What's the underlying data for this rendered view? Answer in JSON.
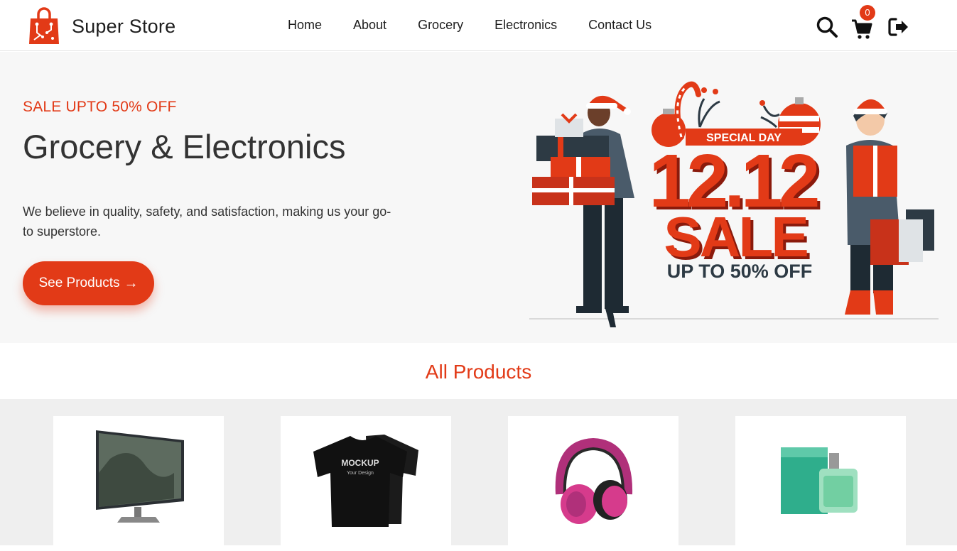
{
  "brand": {
    "name": "Super Store"
  },
  "nav": {
    "items": [
      "Home",
      "About",
      "Grocery",
      "Electronics",
      "Contact Us"
    ]
  },
  "header_actions": {
    "cart_count": "0",
    "icons": [
      "search-icon",
      "cart-icon",
      "logout-icon"
    ]
  },
  "hero": {
    "sale_text": "SALE UPTO 50% OFF",
    "title": "Grocery & Electronics",
    "description": "We believe in quality, safety, and satisfaction, making us your go-to superstore.",
    "button_label": "See Products",
    "banner": {
      "special_day": "SPECIAL DAY",
      "date": "12.12",
      "sale": "SALE",
      "discount": "UP TO 50% OFF"
    }
  },
  "products": {
    "heading": "All Products",
    "items": [
      {
        "name": "monitor"
      },
      {
        "name": "t-shirt",
        "label_line1": "MOCKUP",
        "label_line2": "Your Design"
      },
      {
        "name": "headphones"
      },
      {
        "name": "perfume"
      }
    ]
  },
  "colors": {
    "accent": "#e23a17",
    "hero_bg": "#f7f7f7",
    "products_bg": "#efefef"
  }
}
